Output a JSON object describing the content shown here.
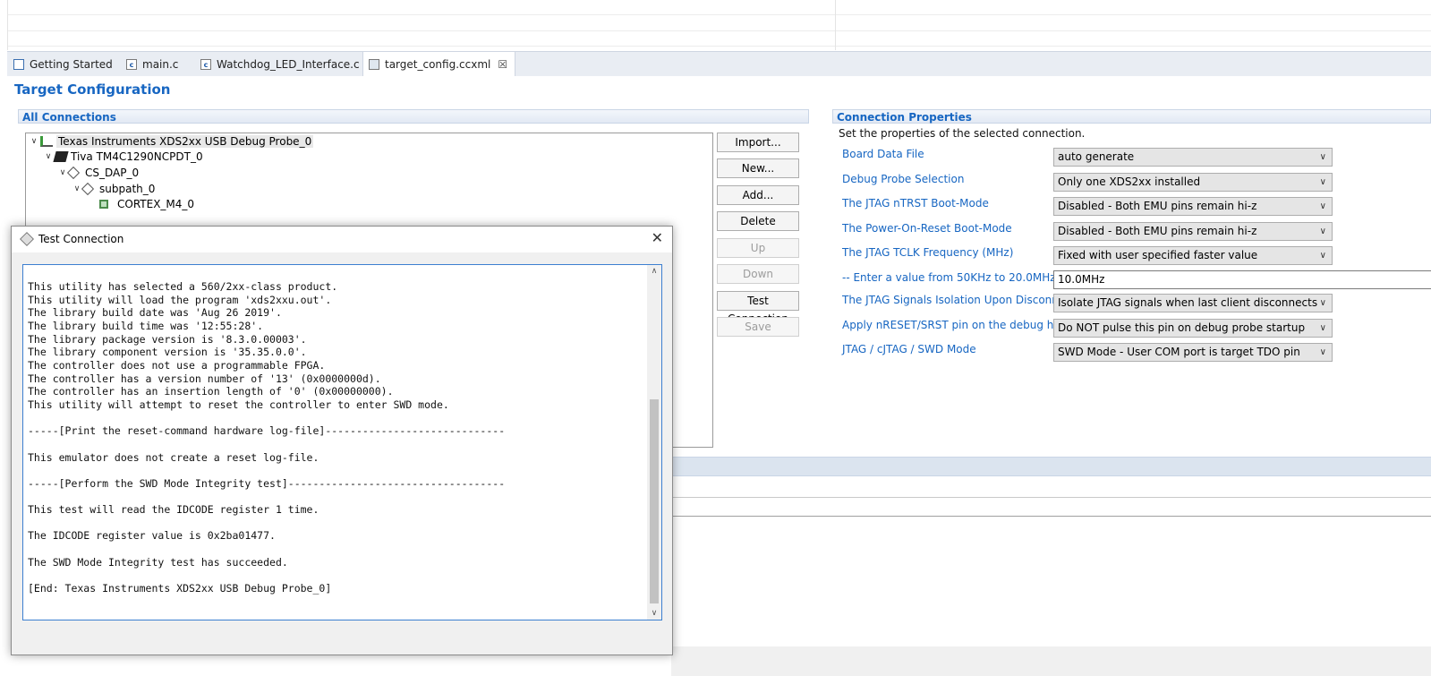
{
  "tabs": [
    {
      "label": "Getting Started",
      "icon": "page-icon"
    },
    {
      "label": "main.c",
      "icon": "c-file-icon"
    },
    {
      "label": "Watchdog_LED_Interface.c",
      "icon": "c-file-icon"
    },
    {
      "label": "target_config.ccxml",
      "icon": "config-file-icon",
      "active": true,
      "close": "☒"
    }
  ],
  "page": {
    "title": "Target Configuration"
  },
  "all_connections": {
    "header": "All Connections",
    "tree": [
      {
        "label": "Texas Instruments XDS2xx USB Debug Probe_0",
        "icon": "probe-icon",
        "expanded": true,
        "selected": true
      },
      {
        "label": "Tiva TM4C1290NCPDT_0",
        "icon": "chip-icon",
        "expanded": true
      },
      {
        "label": "CS_DAP_0",
        "icon": "dap-icon",
        "expanded": true
      },
      {
        "label": "subpath_0",
        "icon": "subpath-icon",
        "expanded": true
      },
      {
        "label": "CORTEX_M4_0",
        "icon": "cpu-core-icon"
      }
    ],
    "buttons": {
      "import": "Import...",
      "new": "New...",
      "add": "Add...",
      "delete": "Delete",
      "up": "Up",
      "down": "Down",
      "test_connection": "Test Connection",
      "save": "Save"
    }
  },
  "connection_properties": {
    "header": "Connection Properties",
    "description": "Set the properties of the selected connection.",
    "props": [
      {
        "label": "Board Data File",
        "value": "auto generate",
        "kind": "select"
      },
      {
        "label": "Debug Probe Selection",
        "value": "Only one XDS2xx installed",
        "kind": "select"
      },
      {
        "label": "The JTAG nTRST Boot-Mode",
        "value": "Disabled - Both EMU pins remain hi-z",
        "kind": "select"
      },
      {
        "label": "The Power-On-Reset Boot-Mode",
        "value": "Disabled - Both EMU pins remain hi-z",
        "kind": "select"
      },
      {
        "label": "The JTAG TCLK Frequency (MHz)",
        "value": "Fixed with user specified faster value",
        "kind": "select"
      },
      {
        "label": "-- Enter a value from 50KHz to 20.0MHz",
        "value": "10.0MHz",
        "kind": "input"
      },
      {
        "label": "The JTAG Signals Isolation Upon Disconnect",
        "value": "Isolate JTAG signals when last client disconnects",
        "kind": "select"
      },
      {
        "label": "Apply nRESET/SRST pin on the debug header",
        "value": "Do NOT pulse this pin on debug probe startup",
        "kind": "select"
      },
      {
        "label": "JTAG / cJTAG / SWD Mode",
        "value": "SWD Mode - User COM port is target TDO pin",
        "kind": "select"
      }
    ]
  },
  "dialog": {
    "title": "Test Connection",
    "close": "✕",
    "log": [
      "This utility has selected a 560/2xx-class product.",
      "This utility will load the program 'xds2xxu.out'.",
      "The library build date was 'Aug 26 2019'.",
      "The library build time was '12:55:28'.",
      "The library package version is '8.3.0.00003'.",
      "The library component version is '35.35.0.0'.",
      "The controller does not use a programmable FPGA.",
      "The controller has a version number of '13' (0x0000000d).",
      "The controller has an insertion length of '0' (0x00000000).",
      "This utility will attempt to reset the controller to enter SWD mode.",
      "",
      "-----[Print the reset-command hardware log-file]-----------------------------",
      "",
      "This emulator does not create a reset log-file.",
      "",
      "-----[Perform the SWD Mode Integrity test]-----------------------------------",
      "",
      "This test will read the IDCODE register 1 time.",
      "",
      "The IDCODE register value is 0x2ba01477.",
      "",
      "The SWD Mode Integrity test has succeeded.",
      "",
      "[End: Texas Instruments XDS2xx USB Debug Probe_0]"
    ]
  }
}
